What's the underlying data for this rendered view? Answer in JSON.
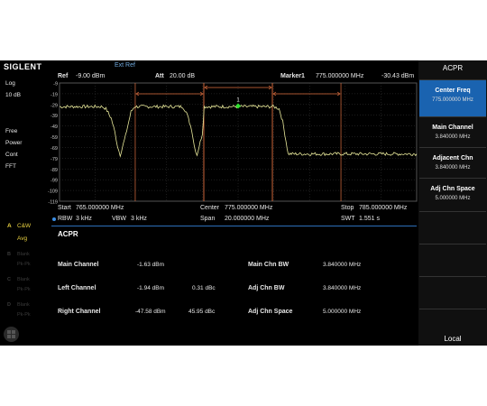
{
  "header": {
    "brand": "SIGLENT",
    "ref_source": "Ext Ref",
    "ref_label": "Ref",
    "ref_value": "-9.00 dBm",
    "att_label": "Att",
    "att_value": "20.00 dB",
    "marker_label": "Marker1",
    "marker_freq": "775.000000 MHz",
    "marker_level": "-30.43 dBm"
  },
  "left_panel": {
    "scale_type": "Log",
    "scale_div": "10 dB",
    "sweep_mode": "Free",
    "detector": "Power",
    "sweep_state": "Cont",
    "fft": "FFT",
    "trace_a_letter": "A",
    "trace_a_mode": "C&W",
    "trace_a_det": "Avg",
    "trace_b_letter": "B",
    "trace_b_mode": "Blank",
    "trace_b_det": "Pk-Pk",
    "trace_c_letter": "C",
    "trace_c_mode": "Blank",
    "trace_c_det": "Pk-Pk",
    "trace_d_letter": "D",
    "trace_d_mode": "Blank",
    "trace_d_det": "Pk-Pk"
  },
  "chart_data": {
    "type": "line",
    "ylabels": [
      "-9",
      "-19",
      "-29",
      "-39",
      "-49",
      "-59",
      "-69",
      "-79",
      "-89",
      "-99",
      "-109",
      "-119"
    ],
    "ylim": [
      -119,
      -9
    ],
    "xlim": [
      765,
      785
    ],
    "x_unit": "MHz",
    "y_unit": "dBm",
    "channels": [
      {
        "name": "left",
        "center": 771.16,
        "bw": 3.84
      },
      {
        "name": "main",
        "center": 775.0,
        "bw": 3.84
      },
      {
        "name": "right",
        "center": 778.84,
        "bw": 3.84
      }
    ],
    "marker": {
      "label": "1",
      "x": 775.0,
      "y": -30.43
    },
    "series": [
      {
        "color": "#e8e89a",
        "x": [
          765.0,
          767.4,
          767.6,
          767.9,
          768.1,
          768.25,
          768.4,
          768.7,
          769.0,
          769.2,
          771.9,
          772.1,
          772.4,
          772.55,
          772.7,
          773.0,
          773.1,
          777.0,
          777.3,
          777.5,
          777.8,
          785.0
        ],
        "y": [
          -31,
          -31,
          -33,
          -42,
          -55,
          -68,
          -76,
          -58,
          -36,
          -31,
          -31,
          -36,
          -52,
          -68,
          -76,
          -56,
          -31,
          -31,
          -33,
          -45,
          -75,
          -75
        ]
      }
    ]
  },
  "footer": {
    "start_label": "Start",
    "start_value": "765.000000 MHz",
    "center_label": "Center",
    "center_value": "775.000000 MHz",
    "stop_label": "Stop",
    "stop_value": "785.000000 MHz",
    "rbw_label": "RBW",
    "rbw_value": "3 kHz",
    "vbw_label": "VBW",
    "vbw_value": "3 kHz",
    "span_label": "Span",
    "span_value": "20.000000 MHz",
    "swt_label": "SWT",
    "swt_value": "1.551 s"
  },
  "results": {
    "title": "ACPR",
    "main_channel_label": "Main Channel",
    "main_channel_value": "-1.63 dBm",
    "left_channel_label": "Left Channel",
    "left_channel_value": "-1.94 dBm",
    "left_channel_rel": "0.31 dBc",
    "right_channel_label": "Right Channel",
    "right_channel_value": "-47.58 dBm",
    "right_channel_rel": "45.95 dBc",
    "main_chn_bw_label": "Main Chn BW",
    "main_chn_bw_value": "3.840000 MHz",
    "adj_chn_bw_label": "Adj Chn BW",
    "adj_chn_bw_value": "3.840000 MHz",
    "adj_chn_space_label": "Adj Chn Space",
    "adj_chn_space_value": "5.000000 MHz"
  },
  "softkeys": {
    "menu_title": "ACPR",
    "center_freq_label": "Center Freq",
    "center_freq_value": "775.000000 MHz",
    "main_channel_label": "Main Channel",
    "main_channel_value": "3.840000 MHz",
    "adjacent_chn_label": "Adjacent Chn",
    "adjacent_chn_value": "3.840000 MHz",
    "adj_chn_space_label": "Adj Chn Space",
    "adj_chn_space_value": "5.000000 MHz",
    "local_label": "Local"
  },
  "colors": {
    "accent": "#1a63b0",
    "trace": "#e8e89a",
    "channel_lines": "#e07040",
    "marker": "#30e030",
    "graticule": "#3a3a3a"
  }
}
